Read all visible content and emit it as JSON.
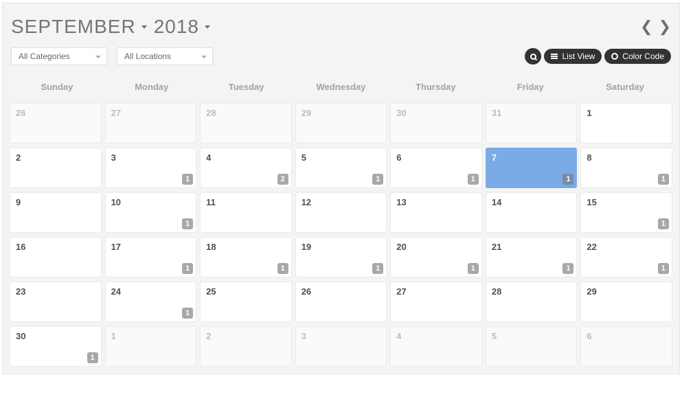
{
  "header": {
    "month": "SEPTEMBER",
    "year": "2018"
  },
  "filters": {
    "categories": "All Categories",
    "locations": "All Locations"
  },
  "buttons": {
    "listView": "List View",
    "colorCode": "Color Code"
  },
  "weekdays": [
    "Sunday",
    "Monday",
    "Tuesday",
    "Wednesday",
    "Thursday",
    "Friday",
    "Saturday"
  ],
  "days": [
    {
      "num": "26",
      "out": true
    },
    {
      "num": "27",
      "out": true
    },
    {
      "num": "28",
      "out": true
    },
    {
      "num": "29",
      "out": true
    },
    {
      "num": "30",
      "out": true
    },
    {
      "num": "31",
      "out": true
    },
    {
      "num": "1"
    },
    {
      "num": "2"
    },
    {
      "num": "3",
      "badge": "1"
    },
    {
      "num": "4",
      "badge": "2"
    },
    {
      "num": "5",
      "badge": "1"
    },
    {
      "num": "6",
      "badge": "1"
    },
    {
      "num": "7",
      "badge": "1",
      "today": true
    },
    {
      "num": "8",
      "badge": "1"
    },
    {
      "num": "9"
    },
    {
      "num": "10",
      "badge": "1"
    },
    {
      "num": "11"
    },
    {
      "num": "12"
    },
    {
      "num": "13"
    },
    {
      "num": "14"
    },
    {
      "num": "15",
      "badge": "1"
    },
    {
      "num": "16"
    },
    {
      "num": "17",
      "badge": "1"
    },
    {
      "num": "18",
      "badge": "1"
    },
    {
      "num": "19",
      "badge": "1"
    },
    {
      "num": "20",
      "badge": "1"
    },
    {
      "num": "21",
      "badge": "1"
    },
    {
      "num": "22",
      "badge": "1"
    },
    {
      "num": "23"
    },
    {
      "num": "24",
      "badge": "1"
    },
    {
      "num": "25"
    },
    {
      "num": "26"
    },
    {
      "num": "27"
    },
    {
      "num": "28"
    },
    {
      "num": "29"
    },
    {
      "num": "30",
      "badge": "1"
    },
    {
      "num": "1",
      "out": true
    },
    {
      "num": "2",
      "out": true
    },
    {
      "num": "3",
      "out": true
    },
    {
      "num": "4",
      "out": true
    },
    {
      "num": "5",
      "out": true
    },
    {
      "num": "6",
      "out": true
    }
  ]
}
